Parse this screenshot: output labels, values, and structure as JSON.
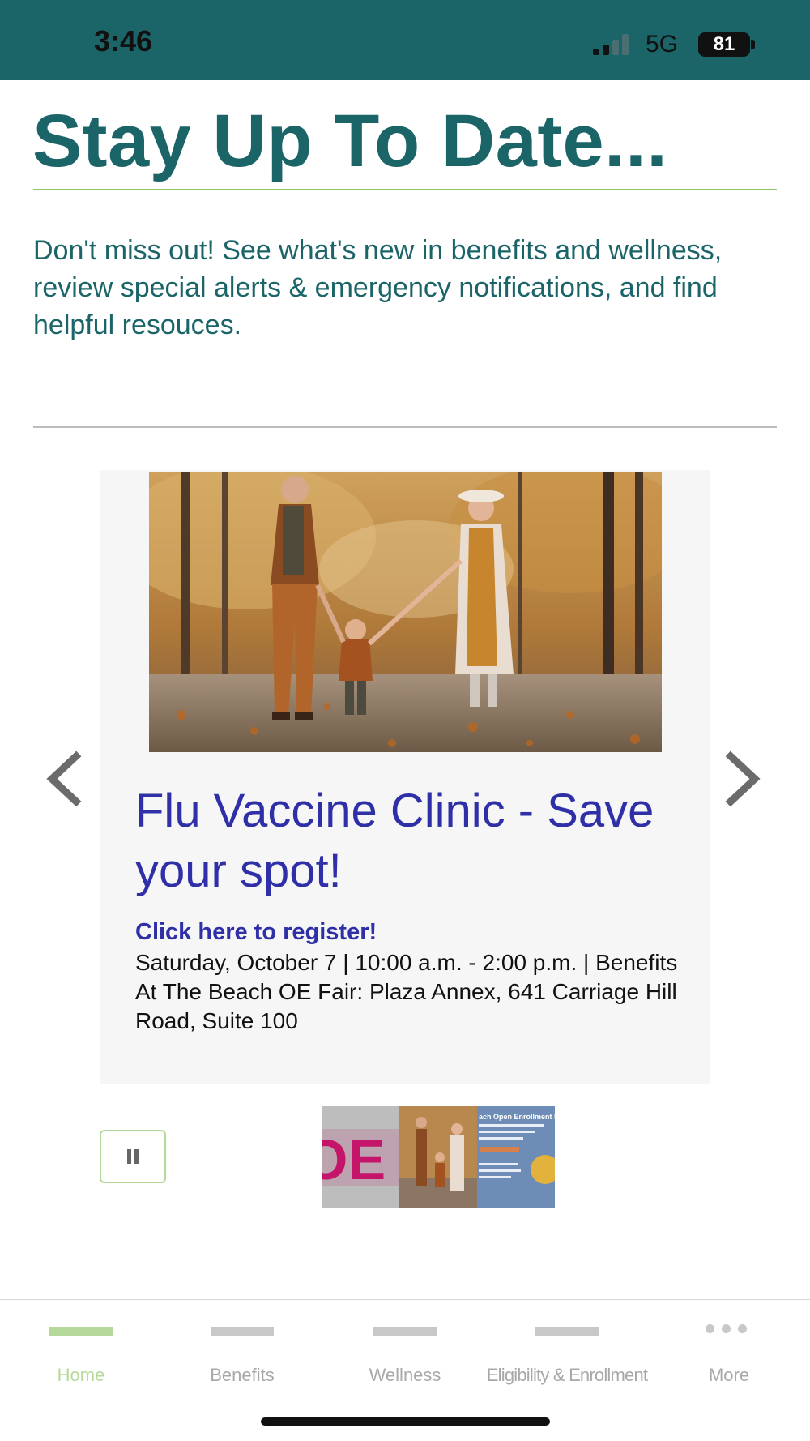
{
  "status_bar": {
    "time": "3:46",
    "network": "5G",
    "battery": "81",
    "background_color": "#1b6468"
  },
  "header": {
    "title": "Stay Up To Date...",
    "intro": "Don't miss out! See what's new in benefits and wellness, review special alerts & emergency notifications, and find helpful resouces.",
    "title_color": "#1b6468",
    "accent_rule_color": "#8dc86c"
  },
  "carousel": {
    "slide": {
      "image_icon": "family-autumn-walk-photo",
      "title": "Flu Vaccine Clinic - Save your spot!",
      "link": "Click here to register!",
      "details": "Saturday, October 7 | 10:00 a.m. - 2:00 p.m. | Benefits At The Beach OE Fair: Plaza Annex, 641 Carriage Hill Road, Suite 100",
      "title_color": "#2f2fa8"
    },
    "prev_icon": "chevron-left-icon",
    "next_icon": "chevron-right-icon",
    "pause_icon": "pause-icon",
    "thumbnails": [
      {
        "label": "OE",
        "icon": "oe-logo-thumbnail"
      },
      {
        "icon": "family-autumn-walk-thumbnail"
      },
      {
        "label": "ach Open Enrollment Fair",
        "icon": "open-enrollment-fair-thumbnail"
      }
    ]
  },
  "tab_bar": {
    "active_color": "#b5d99a",
    "inactive_color": "#a8a8a8",
    "tabs": [
      {
        "label": "Home",
        "active": true
      },
      {
        "label": "Benefits",
        "active": false
      },
      {
        "label": "Wellness",
        "active": false
      },
      {
        "label": "Eligibility & Enrollment",
        "active": false
      },
      {
        "label": "More",
        "active": false,
        "icon": "more-dots-icon"
      }
    ]
  }
}
